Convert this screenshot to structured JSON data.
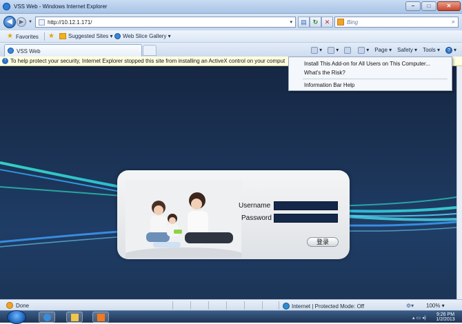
{
  "window": {
    "title": "VSS Web - Windows Internet Explorer"
  },
  "address_bar": {
    "url": "http://10.12.1.171/",
    "search_placeholder": "Bing"
  },
  "favorites_bar": {
    "favorites_label": "Favorites",
    "items": [
      "Suggested Sites ▾",
      "Web Slice Gallery ▾"
    ]
  },
  "tab": {
    "label": "VSS Web"
  },
  "command_bar": {
    "page": "Page ▾",
    "safety": "Safety ▾",
    "tools": "Tools ▾"
  },
  "info_bar": {
    "text": "To help protect your security, Internet Explorer stopped this site from installing an ActiveX control on your comput"
  },
  "context_menu": {
    "items": [
      "Install This Add-on for All Users on This Computer...",
      "What's the Risk?",
      "Information Bar Help"
    ]
  },
  "login": {
    "username_label": "Username",
    "password_label": "Password",
    "login_button": "登录",
    "username_value": "",
    "password_value": ""
  },
  "status_bar": {
    "left": "Done",
    "zone": "Internet | Protected Mode: Off",
    "zoom": "100% ▾"
  },
  "taskbar": {
    "time": "9:26 PM",
    "date": "1/2/2013"
  },
  "colors": {
    "background": "#1b3355",
    "accent": "#2d7fd6"
  }
}
